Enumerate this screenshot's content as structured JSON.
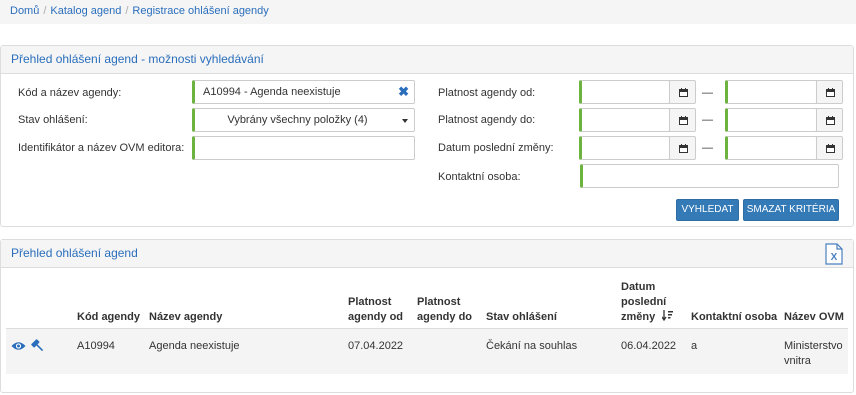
{
  "breadcrumb": {
    "items": [
      "Domů",
      "Katalog agend",
      "Registrace ohlášení agendy"
    ],
    "separator": "/"
  },
  "search_panel": {
    "title": "Přehled ohlášení agend - možnosti vyhledávání",
    "fields": {
      "agenda_code": {
        "label": "Kód a název agendy:",
        "value": "A10994 - Agenda neexistuje"
      },
      "status": {
        "label": "Stav ohlášení:",
        "value": "Vybrány všechny položky (4)"
      },
      "ovm_editor": {
        "label": "Identifikátor a název OVM editora:",
        "value": ""
      },
      "valid_from": {
        "label": "Platnost agendy od:",
        "value_from": "",
        "value_to": ""
      },
      "valid_to": {
        "label": "Platnost agendy do:",
        "value_from": "",
        "value_to": ""
      },
      "last_change": {
        "label": "Datum poslední změny:",
        "value_from": "",
        "value_to": ""
      },
      "contact": {
        "label": "Kontaktní osoba:",
        "value": ""
      }
    },
    "range_separator": "—",
    "buttons": {
      "search": "VYHLEDAT",
      "clear": "SMAZAT KRITÉRIA"
    }
  },
  "list_panel": {
    "title": "Přehled ohlášení agend",
    "export_icon": "excel-export-icon",
    "columns": {
      "code": "Kód agendy",
      "name": "Název agendy",
      "valid_from": [
        "Platnost",
        "agendy od"
      ],
      "valid_to": [
        "Platnost",
        "agendy do"
      ],
      "status": "Stav ohlášení",
      "last_change": [
        "Datum",
        "poslední",
        "změny"
      ],
      "contact": "Kontaktní osoba",
      "ovm": "Název OVM"
    },
    "rows": [
      {
        "icons": [
          "eye-icon",
          "gavel-icon"
        ],
        "code": "A10994",
        "name": "Agenda neexistuje",
        "valid_from": "07.04.2022",
        "valid_to": "",
        "status": "Čekání na souhlas",
        "last_change": "06.04.2022",
        "contact": "a",
        "ovm": [
          "Ministerstvo",
          "vnitra"
        ]
      }
    ]
  },
  "colors": {
    "accent": "#2a6ebb",
    "button": "#337ab7",
    "required": "#6cb33f"
  }
}
